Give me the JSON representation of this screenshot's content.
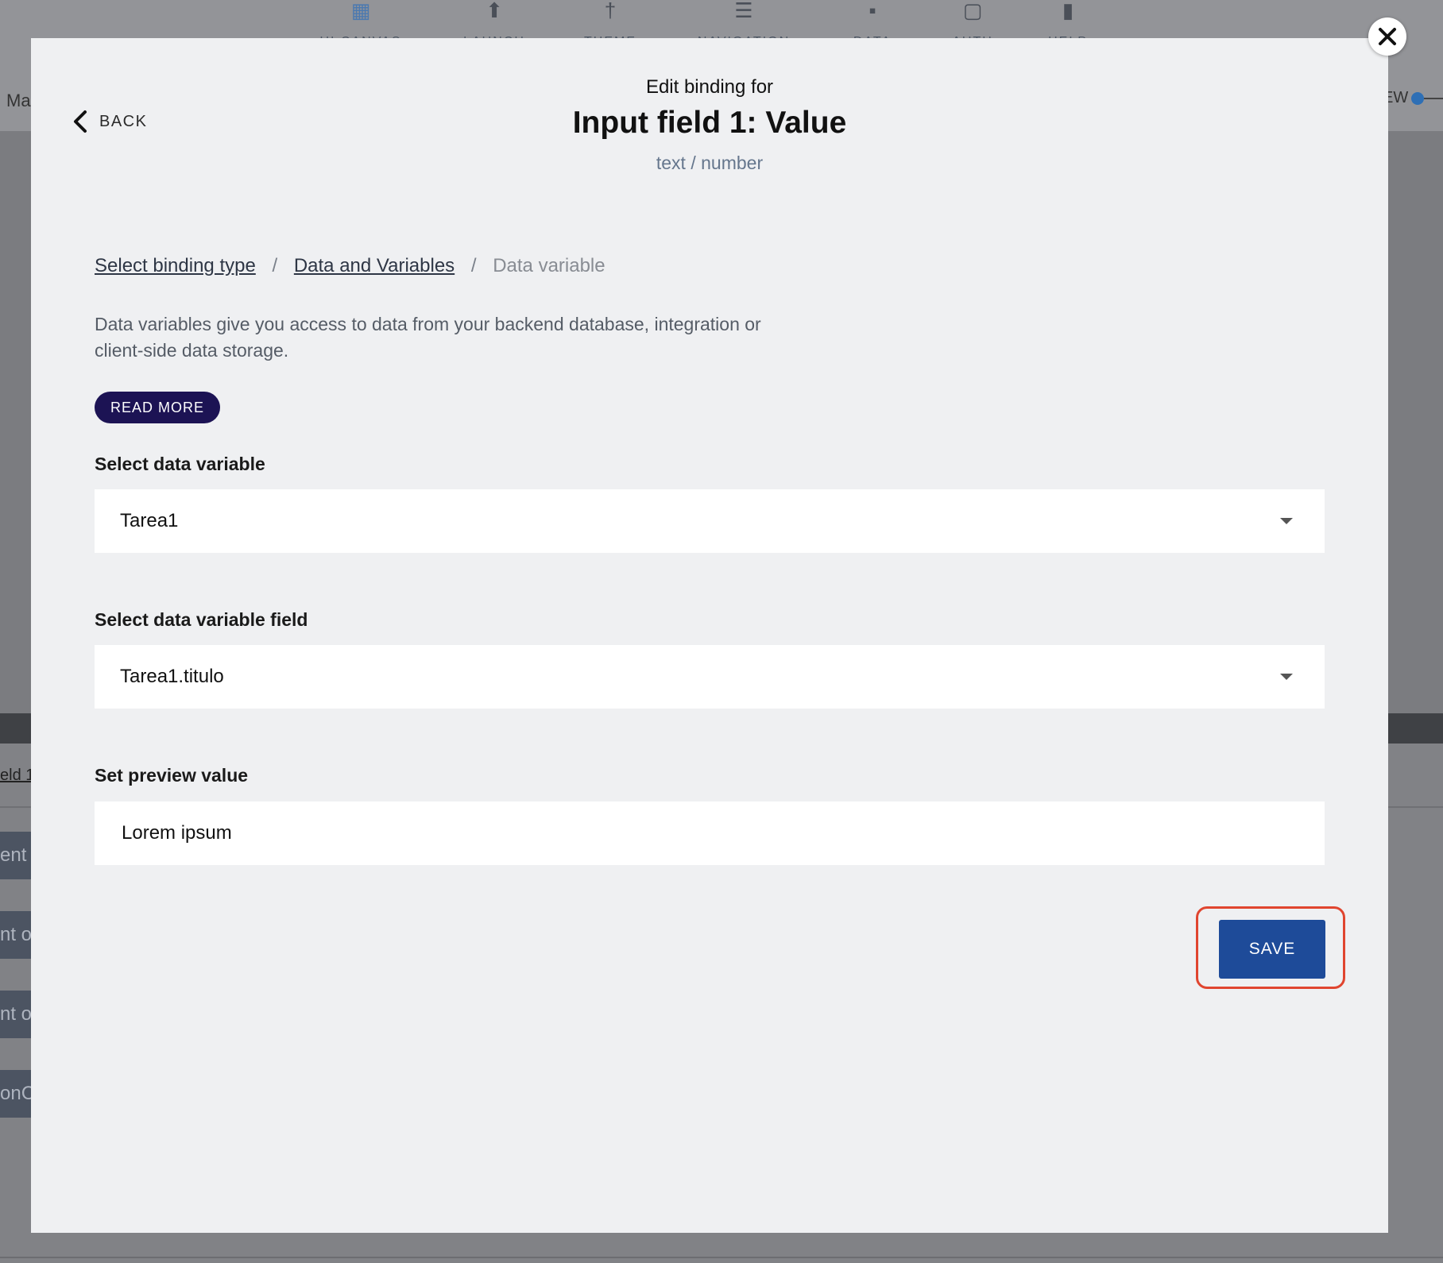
{
  "background": {
    "nav_items": [
      {
        "icon": "canvas-icon",
        "label": "UI CANVAS"
      },
      {
        "icon": "launch-icon",
        "label": "LAUNCH"
      },
      {
        "icon": "theme-icon",
        "label": "THEME"
      },
      {
        "icon": "navigation-icon",
        "label": "NAVIGATION"
      },
      {
        "icon": "folder-icon",
        "label": "DATA"
      },
      {
        "icon": "code-icon",
        "label": "AUTH"
      },
      {
        "icon": "chat-icon",
        "label": "HELP"
      }
    ],
    "left_text": "Ma",
    "right_text": "EW",
    "lower_tab": "eld 1",
    "chips": [
      "ent",
      "nt o",
      "nt o",
      "onC"
    ]
  },
  "modal": {
    "back_label": "BACK",
    "pre_title": "Edit binding for",
    "title": "Input field 1: Value",
    "subtitle": "text / number",
    "breadcrumb": {
      "step1": "Select binding type",
      "step2": "Data and Variables",
      "current": "Data variable",
      "separator": "/"
    },
    "description": "Data variables give you access to data from your backend database, integration or client-side data storage.",
    "read_more_label": "READ MORE",
    "variable_label": "Select data variable",
    "variable_value": "Tarea1",
    "field_label": "Select data variable field",
    "field_value": "Tarea1.titulo",
    "preview_label": "Set preview value",
    "preview_value": "Lorem ipsum",
    "save_label": "SAVE"
  },
  "colors": {
    "modal_bg": "#eff0f2",
    "read_more_bg": "#1c1354",
    "save_bg": "#1e4b99",
    "highlight": "#e0452f"
  }
}
